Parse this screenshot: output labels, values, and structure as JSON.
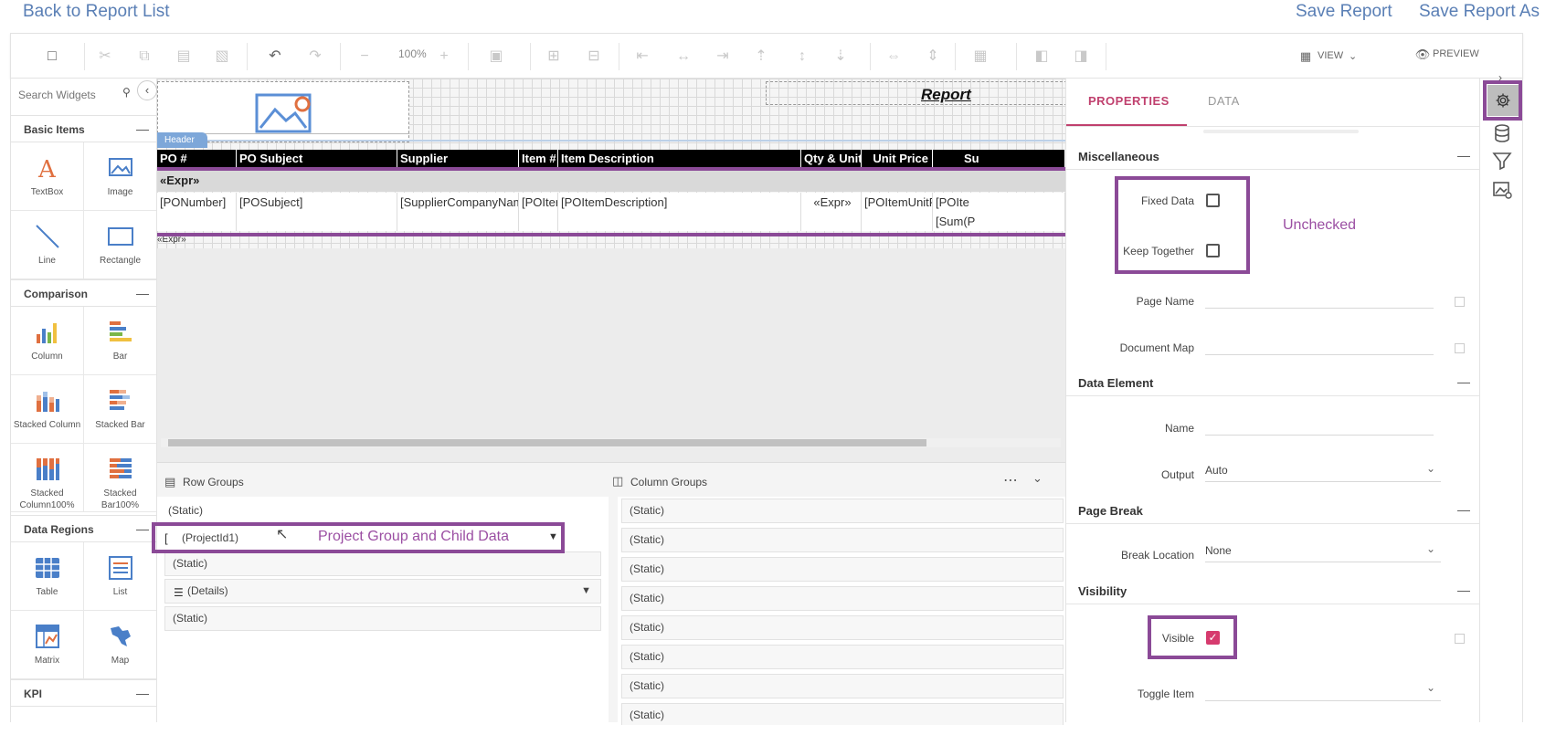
{
  "topbar": {
    "back_label": "Back to Report List",
    "save_label": "Save Report",
    "save_as_label": "Save Report As"
  },
  "toolbar": {
    "zoom": "100%",
    "view_label": "VIEW",
    "preview_label": "PREVIEW"
  },
  "widgets": {
    "search_placeholder": "Search Widgets",
    "categories": [
      {
        "label": "Basic Items",
        "items": [
          "TextBox",
          "Image",
          "Line",
          "Rectangle"
        ]
      },
      {
        "label": "Comparison",
        "items": [
          "Column",
          "Bar",
          "Stacked Column",
          "Stacked Bar",
          "Stacked Column100%",
          "Stacked Bar100%"
        ]
      },
      {
        "label": "Data Regions",
        "items": [
          "Table",
          "List",
          "Matrix",
          "Map"
        ]
      },
      {
        "label": "KPI",
        "items": []
      }
    ]
  },
  "canvas": {
    "report_title": "Report",
    "header_tag": "Header",
    "columns": [
      "PO #",
      "PO Subject",
      "Supplier",
      "Item #",
      "Item Description",
      "Qty & Unit",
      "Unit Price",
      "Su"
    ],
    "group_row": "«Expr»",
    "detail_row": [
      "[PONumber]",
      "[POSubject]",
      "[SupplierCompanyNam",
      "[POIter",
      "[POItemDescription]",
      "«Expr»",
      "[POItemUnitF",
      "[POIte"
    ],
    "total_row_last": "[Sum(P",
    "footer_expr": "«Expr»"
  },
  "groups": {
    "row_title": "Row Groups",
    "column_title": "Column Groups",
    "row_items": [
      "(Static)",
      "(ProjectId1)",
      "(Static)",
      "(Details)",
      "(Static)"
    ],
    "column_items": [
      "(Static)",
      "(Static)",
      "(Static)",
      "(Static)",
      "(Static)",
      "(Static)",
      "(Static)",
      "(Static)"
    ],
    "annotation": "Project Group and Child Data"
  },
  "properties": {
    "tab_properties": "PROPERTIES",
    "tab_data": "DATA",
    "sections": {
      "misc": "Miscellaneous",
      "data_element": "Data Element",
      "page_break": "Page Break",
      "visibility": "Visibility"
    },
    "fixed_data_label": "Fixed Data",
    "keep_together_label": "Keep Together",
    "unchecked_annotation": "Unchecked",
    "page_name_label": "Page Name",
    "document_map_label": "Document Map",
    "name_label": "Name",
    "output_label": "Output",
    "output_value": "Auto",
    "break_location_label": "Break Location",
    "break_location_value": "None",
    "visible_label": "Visible",
    "toggle_item_label": "Toggle Item"
  },
  "colors": {
    "accent": "#d63b6e",
    "highlight": "#8b4a97",
    "link": "#5a7fb5"
  }
}
